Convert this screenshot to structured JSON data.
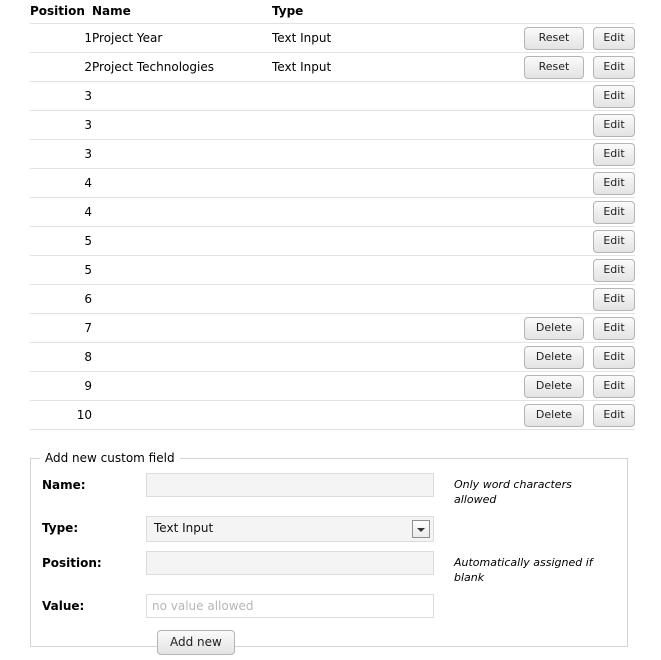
{
  "table": {
    "columns": [
      "Position",
      "Name",
      "Type",
      ""
    ],
    "rows": [
      {
        "position": "1",
        "name": "Project Year",
        "type": "Text Input",
        "actions": [
          "Reset",
          "Edit"
        ]
      },
      {
        "position": "2",
        "name": "Project Technologies",
        "type": "Text Input",
        "actions": [
          "Reset",
          "Edit"
        ]
      },
      {
        "position": "3",
        "name": "",
        "type": "",
        "actions": [
          "Edit"
        ]
      },
      {
        "position": "3",
        "name": "",
        "type": "",
        "actions": [
          "Edit"
        ]
      },
      {
        "position": "3",
        "name": "",
        "type": "",
        "actions": [
          "Edit"
        ]
      },
      {
        "position": "4",
        "name": "",
        "type": "",
        "actions": [
          "Edit"
        ]
      },
      {
        "position": "4",
        "name": "",
        "type": "",
        "actions": [
          "Edit"
        ]
      },
      {
        "position": "5",
        "name": "",
        "type": "",
        "actions": [
          "Edit"
        ]
      },
      {
        "position": "5",
        "name": "",
        "type": "",
        "actions": [
          "Edit"
        ]
      },
      {
        "position": "6",
        "name": "",
        "type": "",
        "actions": [
          "Edit"
        ]
      },
      {
        "position": "7",
        "name": "",
        "type": "",
        "actions": [
          "Delete",
          "Edit"
        ]
      },
      {
        "position": "8",
        "name": "",
        "type": "",
        "actions": [
          "Delete",
          "Edit"
        ]
      },
      {
        "position": "9",
        "name": "",
        "type": "",
        "actions": [
          "Delete",
          "Edit"
        ]
      },
      {
        "position": "10",
        "name": "",
        "type": "",
        "actions": [
          "Delete",
          "Edit"
        ]
      }
    ]
  },
  "form": {
    "legend": "Add new custom field",
    "name": {
      "label": "Name:",
      "value": "",
      "placeholder": "",
      "hint": "Only word characters allowed"
    },
    "type": {
      "label": "Type:",
      "selected": "Text Input",
      "options": [
        "Text Input"
      ],
      "hint": ""
    },
    "position": {
      "label": "Position:",
      "value": "",
      "placeholder": "",
      "hint": "Automatically assigned if blank"
    },
    "value": {
      "label": "Value:",
      "value": "",
      "placeholder": "no value allowed",
      "hint": ""
    },
    "submit_label": "Add new"
  },
  "colors": {
    "row_border": "#e2e2e2",
    "input_bg": "#f4f4f4",
    "input_border": "#dcdcdc",
    "button_bg": "#ededed",
    "button_border": "#b4b4b4",
    "fieldset_border": "#d4d4d4",
    "placeholder_text": "#b6b6b6"
  }
}
